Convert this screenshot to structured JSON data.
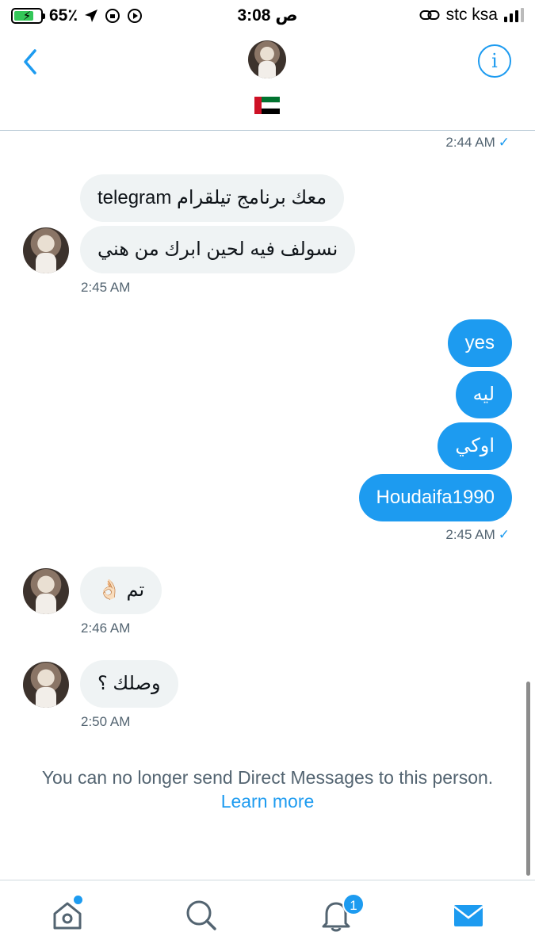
{
  "status_bar": {
    "battery": "65٪",
    "time": "3:08 ص",
    "carrier": "stc ksa"
  },
  "header": {
    "flag": "🇦🇪"
  },
  "messages": {
    "t1": "2:44 AM",
    "in1": "معك برنامج تيلقرام telegram",
    "in2": "نسولف فيه لحين ابرك من هني",
    "t2": "2:45 AM",
    "out1": "yes",
    "out2": "ليه",
    "out3": "اوكي",
    "out4": "Houdaifa1990",
    "t3": "2:45 AM",
    "in3": "تم 👌🏻",
    "t4": "2:46 AM",
    "in4": "وصلك ؟",
    "t5": "2:50 AM"
  },
  "notice": {
    "text": "You can no longer send Direct Messages to this person.",
    "link": "Learn more"
  },
  "tabs": {
    "notifications_badge": "1"
  },
  "colors": {
    "accent": "#1d9bf0",
    "incoming_bubble": "#eff3f4",
    "muted_text": "#536471"
  }
}
